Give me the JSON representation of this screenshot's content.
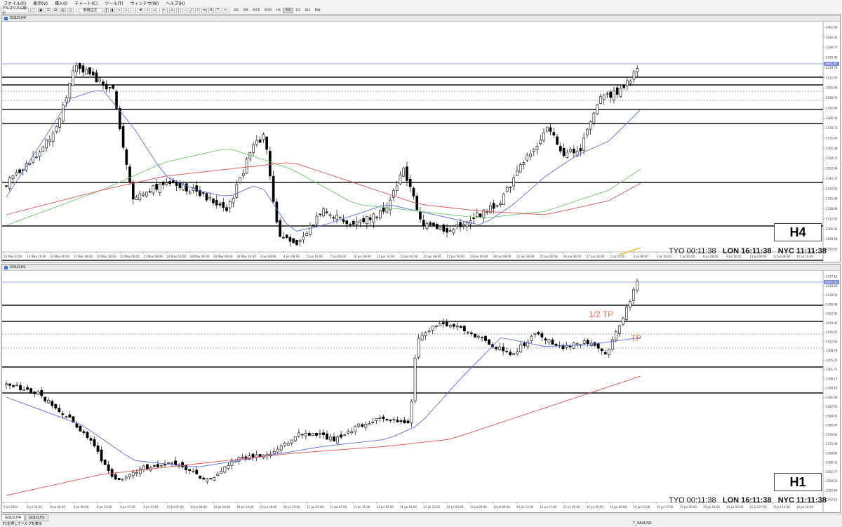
{
  "menu": [
    "ファイル(F)",
    "表示(V)",
    "挿入(I)",
    "チャート(C)",
    "ツール(T)",
    "ウィンドウ(W)",
    "ヘルプ(H)"
  ],
  "toolbar": {
    "algo_label": "アルゴリズム取引",
    "new_order_label": "新規注文",
    "timeframes": [
      "M1",
      "M5",
      "M15",
      "M30",
      "H1",
      "H4",
      "D1",
      "W1",
      "MN"
    ],
    "active_timeframe": "H4"
  },
  "charts": [
    {
      "title": "GOLD,H4",
      "timeframe_label": "H4",
      "clock": {
        "tyo": "TYO 00:11:38",
        "lon": "LON 16:11:38",
        "nyc": "NYC 11:11:38"
      },
      "price_ticks": [
        "2462.00",
        "2445.42",
        "2436.77",
        "2425.45",
        "2419.74",
        "2412.07",
        "2405.40",
        "2398.73",
        "2392.06",
        "2385.39",
        "2378.72",
        "2372.05",
        "2365.38",
        "2358.71",
        "2352.04",
        "2345.37",
        "2332.03",
        "2325.36",
        "2318.69",
        "2312.02",
        "2305.35",
        "2298.68",
        "2292.01"
      ],
      "current_price": "2431.29",
      "date_ticks": [
        "13 May 2024",
        "14 May 16:00",
        "16 May 00:00",
        "17 May 08:00",
        "20 May 16:00",
        "22 May 00:00",
        "23 May 08:00",
        "24 May 16:00",
        "28 May 00:00",
        "29 May 08:00",
        "30 May 16:00",
        "3 Jun 00:00",
        "4 Jun 08:00",
        "5 Jun 16:00",
        "7 Jun 00:00",
        "10 Jun 08:00",
        "11 Jun 16:00",
        "13 Jun 00:00",
        "14 Jun 08:00",
        "17 Jun 16:00",
        "19 Jun 00:00",
        "20 Jun 08:00",
        "21 Jun 16:00",
        "25 Jun 00:00",
        "26 Jun 08:00",
        "27 Jun 16:00",
        "1 Jul 00:00",
        "2 Jul 08:00",
        "3 Jul 16:00",
        "5 Jul 00:00",
        "8 Jul 08:00",
        "9 Jul 16:00",
        "11 Jul 00:00",
        "12 Jul 08:00",
        "15 Jul 16:00"
      ],
      "colors": {
        "ma_fast": "#5b6ee8",
        "ma_mid": "#6fc86f",
        "ma_slow": "#e05050",
        "current": "#7d8ae0",
        "trend": "#e8c020"
      }
    },
    {
      "title": "GOLD,H1",
      "timeframe_label": "H1",
      "clock": {
        "tyo": "TYO 00:11:38",
        "lon": "LON 16:11:38",
        "nyc": "NYC 11:11:38"
      },
      "annotations": {
        "half_tp": "1/2 TP",
        "tp": "TP"
      },
      "price_ticks": [
        "2437.15",
        "2433.29",
        "2430.03",
        "2426.46",
        "2422.95",
        "2419.46",
        "2415.97",
        "2412.55",
        "2408.79",
        "2405.25",
        "2401.71",
        "2398.17",
        "2394.63",
        "2391.09",
        "2387.55",
        "2384.01",
        "2380.47",
        "2376.93",
        "2373.39",
        "2369.85",
        "2366.31",
        "2362.77",
        "2359.23",
        "2355.69",
        "2352.15"
      ],
      "current_price": "2431.29",
      "date_ticks": [
        "5 Jul 2024",
        "8 Jul 02:00",
        "8 Jul 06:00",
        "8 Jul 09:00",
        "8 Jul 13:00",
        "9 Jul 17:00",
        "9 Jul 21:00",
        "10 Jul 01:00",
        "10 Jul 06:00",
        "10 Jul 10:00",
        "10 Jul 14:00",
        "10 Jul 18:00",
        "10 Jul 22:00",
        "11 Jul 02:00",
        "11 Jul 07:00",
        "11 Jul 11:00",
        "11 Jul 15:00",
        "11 Jul 19:00",
        "11 Jul 23:00",
        "12 Jul 03:00",
        "12 Jul 06:00",
        "12 Jul 09:00",
        "12 Jul 13:00",
        "12 Jul 17:00",
        "15 Jul 01:00",
        "15 Jul 05:00",
        "15 Jul 09:00",
        "15 Jul 13:00",
        "15 Jul 17:00",
        "15 Jul 20:00",
        "15 Jul 23:00",
        "15 Jul 03:00",
        "15 Jul 07:00",
        "15 Jul 14:00",
        "15 Jul 18:00"
      ],
      "colors": {
        "ma_fast": "#5b6ee8",
        "ma_slow": "#e05050",
        "current": "#7d8ae0"
      }
    }
  ],
  "status": {
    "tabs": [
      "GOLD,H4",
      "GOLD,H1"
    ],
    "active_tab": "GOLD,H4",
    "help": "F1を押してヘルプを表示",
    "symbol": "T_XAUUSD"
  }
}
